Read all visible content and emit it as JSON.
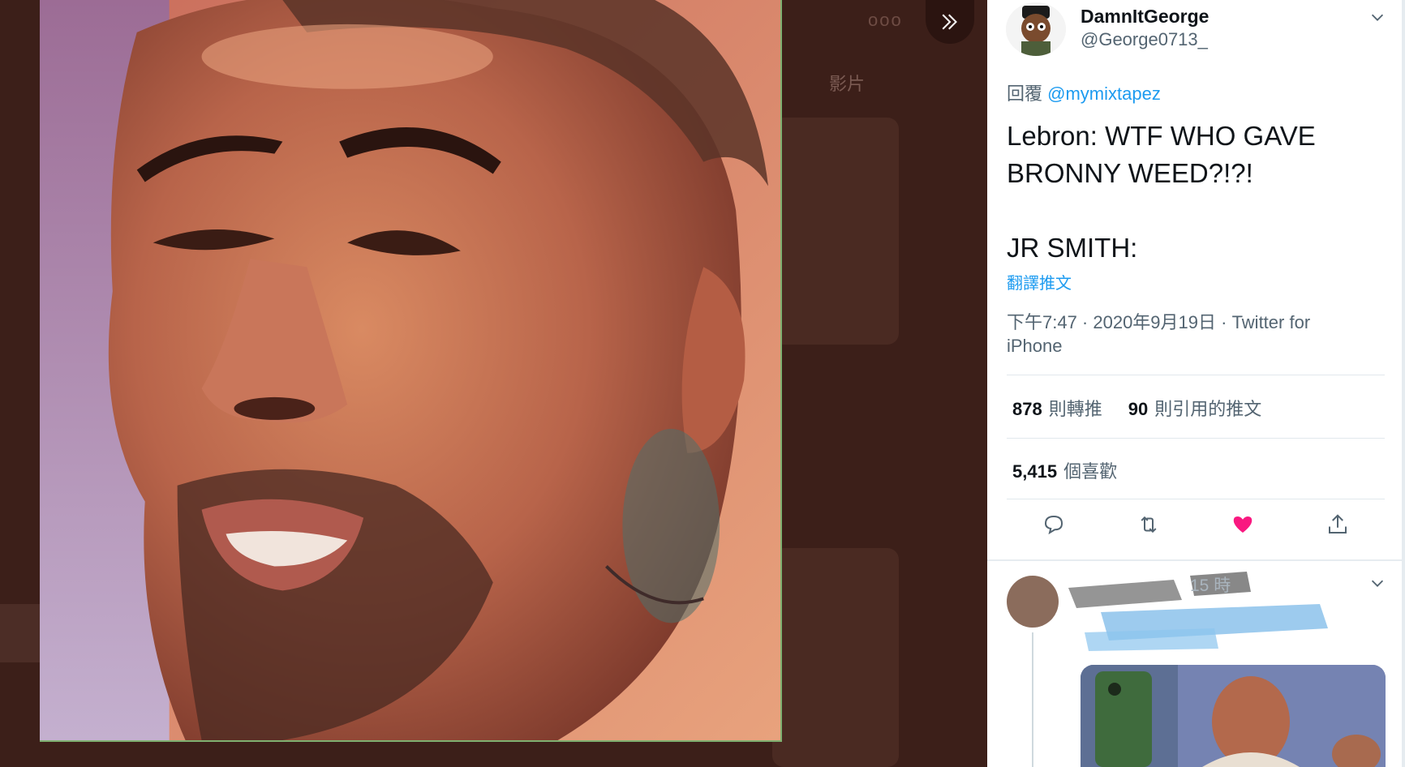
{
  "backdrop": {
    "tab_label": "影片",
    "more_label": "ooo"
  },
  "tweet": {
    "display_name": "DamnItGeorge",
    "handle": "@George0713_",
    "reply_prefix": "回覆",
    "reply_mention": "@mymixtapez",
    "text": "Lebron: WTF WHO GAVE BRONNY WEED?!?!\n\nJR SMITH:",
    "translate_label": "翻譯推文",
    "meta": "下午7:47 · 2020年9月19日 · Twitter for iPhone",
    "retweets_count": "878",
    "retweets_label": "則轉推",
    "quotes_count": "90",
    "quotes_label": "則引用的推文",
    "likes_count": "5,415",
    "likes_label": "個喜歡"
  },
  "reply": {
    "meta": "15 時"
  },
  "icons": {
    "expand": "double-chevron-right-icon",
    "caret": "chevron-down-icon",
    "reply": "speech-bubble-icon",
    "retweet": "retweet-icon",
    "like": "heart-filled-icon",
    "share": "share-icon"
  },
  "colors": {
    "link": "#1d9bf0",
    "like": "#f91880",
    "secondary_text": "#536471",
    "backdrop": "#3c1f19"
  }
}
